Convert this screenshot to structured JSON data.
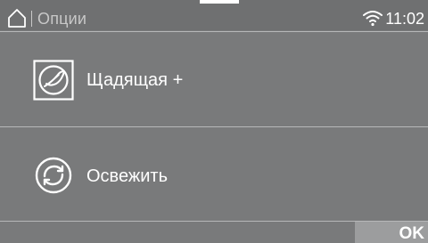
{
  "status_bar": {
    "home_icon": "home-icon",
    "title": "Опции",
    "wifi_icon": "wifi-icon",
    "time": "11:02"
  },
  "options": [
    {
      "label": "Щадящая +",
      "icon": "gentle-care-icon"
    },
    {
      "label": "Освежить",
      "icon": "refresh-icon"
    }
  ],
  "bottom_bar": {
    "ok_label": "OK"
  },
  "colors": {
    "background": "#797a7b",
    "status_bar": "#6f7071",
    "separator": "#b7b8b9",
    "ok_button": "#9c9d9e",
    "text": "#ffffff",
    "title_text": "#c8c8c8"
  }
}
